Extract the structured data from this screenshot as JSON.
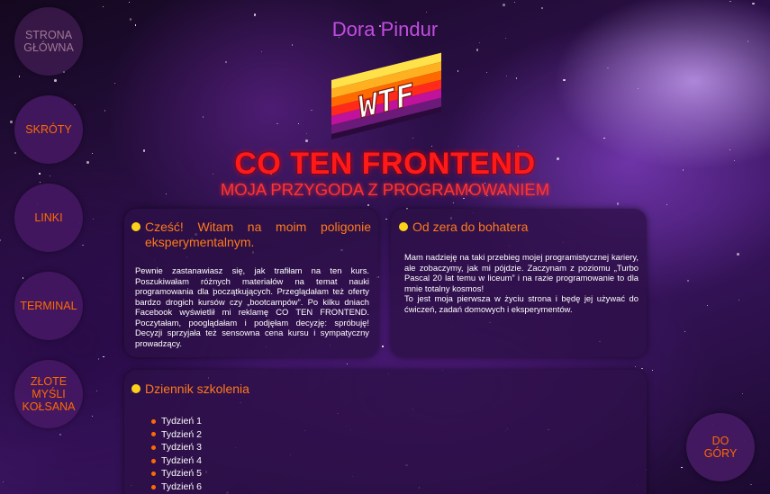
{
  "nav": {
    "home": "STRONA GŁÓWNA",
    "shortcuts": "SKRÓTY",
    "links": "LINKI",
    "terminal": "TERMINAL",
    "quotes": "ZŁOTE MYŚLI KOŁSANA"
  },
  "author": "Dora Pindur",
  "logo_text": "WTF",
  "title": "CO TEN FRONTEND",
  "subtitle": "MOJA PRZYGODA Z PROGRAMOWANIEM",
  "card_welcome": {
    "heading": "Cześć! Witam na moim poligonie eksperymentalnym.",
    "body": "Pewnie zastanawiasz się, jak trafiłam na ten kurs. Poszukiwałam różnych materiałów na temat nauki programowania dla początkujących. Przeglądałam też oferty bardzo drogich kursów czy „bootcampów”. Po kilku dniach Facebook wyświetlił mi reklamę CO TEN FRONTEND. Poczytałam, pooglądałam i podjęłam decyzję: spróbuję! Decyzji sprzyjała też sensowna cena kursu i sympatyczny prowadzący."
  },
  "card_hero": {
    "heading": "Od zera do bohatera",
    "body1": "Mam nadzieję na taki przebieg mojej programistycznej kariery, ale zobaczymy, jak mi pójdzie. Zaczynam z poziomu „Turbo Pascal 20 lat temu w liceum” i na razie programowanie to dla mnie totalny kosmos!",
    "body2": "To jest moja pierwsza w życiu strona i będę jej używać do ćwiczeń, zadań domowych i eksperymentów."
  },
  "card_journal": {
    "heading": "Dziennik szkolenia",
    "weeks": [
      "Tydzień 1",
      "Tydzień 2",
      "Tydzień 3",
      "Tydzień 4",
      "Tydzień 5",
      "Tydzień 6"
    ]
  },
  "back_to_top": "DO GÓRY",
  "colors": {
    "accent_orange": "#ff6a00",
    "title_red": "#ff1a1a",
    "author_purple": "#c14ee0",
    "bullet_yellow": "#ffd21a"
  }
}
